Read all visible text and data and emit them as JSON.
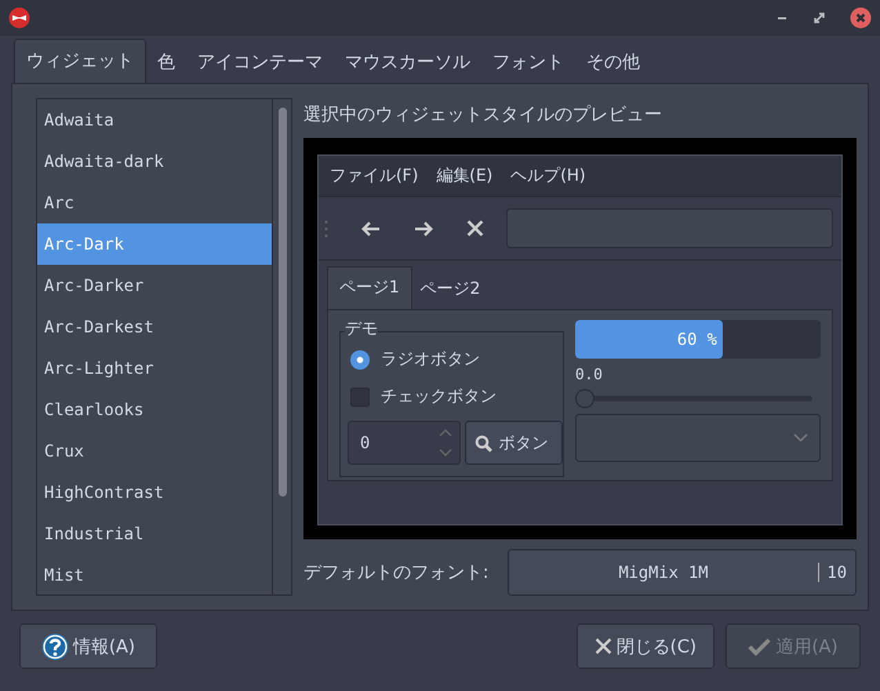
{
  "tabs": [
    {
      "label": "ウィジェット",
      "selected": true
    },
    {
      "label": "色",
      "selected": false
    },
    {
      "label": "アイコンテーマ",
      "selected": false
    },
    {
      "label": "マウスカーソル",
      "selected": false
    },
    {
      "label": "フォント",
      "selected": false
    },
    {
      "label": "その他",
      "selected": false
    }
  ],
  "themes": [
    {
      "label": "Adwaita",
      "selected": false
    },
    {
      "label": "Adwaita-dark",
      "selected": false
    },
    {
      "label": "Arc",
      "selected": false
    },
    {
      "label": "Arc-Dark",
      "selected": true
    },
    {
      "label": "Arc-Darker",
      "selected": false
    },
    {
      "label": "Arc-Darkest",
      "selected": false
    },
    {
      "label": "Arc-Lighter",
      "selected": false
    },
    {
      "label": "Clearlooks",
      "selected": false
    },
    {
      "label": "Crux",
      "selected": false
    },
    {
      "label": "HighContrast",
      "selected": false
    },
    {
      "label": "Industrial",
      "selected": false
    },
    {
      "label": "Mist",
      "selected": false
    }
  ],
  "preview_title": "選択中のウィジェットスタイルのプレビュー",
  "preview": {
    "menus": [
      "ファイル(F)",
      "編集(E)",
      "ヘルプ(H)"
    ],
    "page_tabs": [
      {
        "label": "ページ1",
        "selected": true
      },
      {
        "label": "ページ2",
        "selected": false
      }
    ],
    "group_title": "デモ",
    "radio": {
      "label": "ラジオボタン",
      "selected": true
    },
    "checkbox": {
      "label": "チェックボタン",
      "checked": false
    },
    "spin_value": "0",
    "button": "ボタン",
    "progress": {
      "level": 0.6,
      "reading": "60 %"
    },
    "slider": {
      "level": 0,
      "reading": "0.0"
    }
  },
  "font_label": "デフォルトのフォント:",
  "font_name": "MigMix 1M",
  "font_size": "10",
  "buttons": [
    {
      "kind": "info",
      "label": "情報(A)",
      "disabled": false
    },
    {
      "kind": "close",
      "label": "閉じる(C)",
      "disabled": false
    },
    {
      "kind": "apply",
      "label": "適用(A)",
      "disabled": true
    }
  ]
}
